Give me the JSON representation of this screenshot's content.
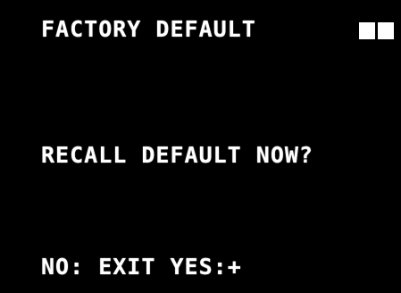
{
  "screen": {
    "title": "FACTORY DEFAULT",
    "status_indicator": "block-indicator-icon",
    "prompt": "RECALL DEFAULT NOW?",
    "options": {
      "no_label": "NO: EXIT",
      "yes_label": "YES:",
      "yes_symbol": "+"
    }
  },
  "colors": {
    "background": "#000000",
    "text": "#ffffff"
  }
}
